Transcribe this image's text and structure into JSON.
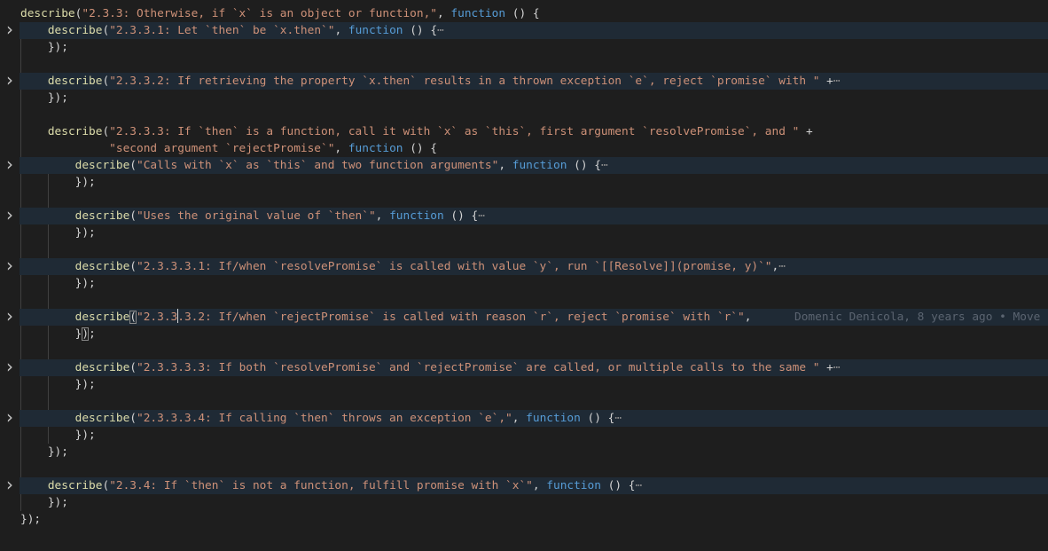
{
  "colors": {
    "background": "#1e1e1e",
    "function": "#dcdcaa",
    "string": "#ce9178",
    "keyword": "#569cd6",
    "fold_highlight": "#1f2a35"
  },
  "fold_icon": "chevron-right-icon",
  "blame": "Domenic Denicola, 8 years ago • Move",
  "lines": [
    {
      "indent": 0,
      "tokens": [
        [
          "fn",
          "describe"
        ],
        [
          "p",
          "("
        ],
        [
          "str",
          "\"2.3.3: Otherwise, if `x` is an object or function,\""
        ],
        [
          "p",
          ", "
        ],
        [
          "kw",
          "function"
        ],
        [
          "p",
          " () {"
        ]
      ]
    },
    {
      "indent": 4,
      "folded": true,
      "tokens": [
        [
          "fn",
          "describe"
        ],
        [
          "p",
          "("
        ],
        [
          "str",
          "\"2.3.3.1: Let `then` be `x.then`\""
        ],
        [
          "p",
          ", "
        ],
        [
          "kw",
          "function"
        ],
        [
          "p",
          " () {"
        ],
        [
          "ell",
          "⋯"
        ]
      ]
    },
    {
      "indent": 4,
      "tokens": [
        [
          "p",
          "});"
        ]
      ]
    },
    {
      "indent": 0,
      "tokens": []
    },
    {
      "indent": 4,
      "folded": true,
      "tokens": [
        [
          "fn",
          "describe"
        ],
        [
          "p",
          "("
        ],
        [
          "str",
          "\"2.3.3.2: If retrieving the property `x.then` results in a thrown exception `e`, reject `promise` with \""
        ],
        [
          "p",
          " +"
        ],
        [
          "ell",
          "⋯"
        ]
      ]
    },
    {
      "indent": 4,
      "tokens": [
        [
          "p",
          "});"
        ]
      ]
    },
    {
      "indent": 0,
      "tokens": []
    },
    {
      "indent": 4,
      "tokens": [
        [
          "fn",
          "describe"
        ],
        [
          "p",
          "("
        ],
        [
          "str",
          "\"2.3.3.3: If `then` is a function, call it with `x` as `this`, first argument `resolvePromise`, and \""
        ],
        [
          "p",
          " +"
        ]
      ]
    },
    {
      "indent": 13,
      "tokens": [
        [
          "str",
          "\"second argument `rejectPromise`\""
        ],
        [
          "p",
          ", "
        ],
        [
          "kw",
          "function"
        ],
        [
          "p",
          " () {"
        ]
      ]
    },
    {
      "indent": 8,
      "folded": true,
      "tokens": [
        [
          "fn",
          "describe"
        ],
        [
          "p",
          "("
        ],
        [
          "str",
          "\"Calls with `x` as `this` and two function arguments\""
        ],
        [
          "p",
          ", "
        ],
        [
          "kw",
          "function"
        ],
        [
          "p",
          " () {"
        ],
        [
          "ell",
          "⋯"
        ]
      ]
    },
    {
      "indent": 8,
      "tokens": [
        [
          "p",
          "});"
        ]
      ]
    },
    {
      "indent": 0,
      "tokens": []
    },
    {
      "indent": 8,
      "folded": true,
      "tokens": [
        [
          "fn",
          "describe"
        ],
        [
          "p",
          "("
        ],
        [
          "str",
          "\"Uses the original value of `then`\""
        ],
        [
          "p",
          ", "
        ],
        [
          "kw",
          "function"
        ],
        [
          "p",
          " () {"
        ],
        [
          "ell",
          "⋯"
        ]
      ]
    },
    {
      "indent": 8,
      "tokens": [
        [
          "p",
          "});"
        ]
      ]
    },
    {
      "indent": 0,
      "tokens": []
    },
    {
      "indent": 8,
      "folded": true,
      "tokens": [
        [
          "fn",
          "describe"
        ],
        [
          "p",
          "("
        ],
        [
          "str",
          "\"2.3.3.3.1: If/when `resolvePromise` is called with value `y`, run `[[Resolve]](promise, y)`\""
        ],
        [
          "p",
          ","
        ],
        [
          "ell",
          "⋯"
        ]
      ]
    },
    {
      "indent": 8,
      "tokens": [
        [
          "p",
          "});"
        ]
      ]
    },
    {
      "indent": 0,
      "tokens": []
    },
    {
      "indent": 8,
      "folded": true,
      "blame": true,
      "tokens": [
        [
          "fn",
          "describe"
        ],
        [
          "bm",
          "("
        ],
        [
          "str",
          "\"2.3.3"
        ],
        [
          "cursor",
          ""
        ],
        [
          "str",
          ".3.2: If/when `rejectPromise` is called with reason `r`, reject `promise` with `r`\""
        ],
        [
          "p",
          ","
        ]
      ]
    },
    {
      "indent": 8,
      "tokens": [
        [
          "p",
          "}"
        ],
        [
          "bm",
          ")"
        ],
        [
          "p",
          ";"
        ]
      ]
    },
    {
      "indent": 0,
      "tokens": []
    },
    {
      "indent": 8,
      "folded": true,
      "tokens": [
        [
          "fn",
          "describe"
        ],
        [
          "p",
          "("
        ],
        [
          "str",
          "\"2.3.3.3.3: If both `resolvePromise` and `rejectPromise` are called, or multiple calls to the same \""
        ],
        [
          "p",
          " +"
        ],
        [
          "ell",
          "⋯"
        ]
      ]
    },
    {
      "indent": 8,
      "tokens": [
        [
          "p",
          "});"
        ]
      ]
    },
    {
      "indent": 0,
      "tokens": []
    },
    {
      "indent": 8,
      "folded": true,
      "tokens": [
        [
          "fn",
          "describe"
        ],
        [
          "p",
          "("
        ],
        [
          "str",
          "\"2.3.3.3.4: If calling `then` throws an exception `e`,\""
        ],
        [
          "p",
          ", "
        ],
        [
          "kw",
          "function"
        ],
        [
          "p",
          " () {"
        ],
        [
          "ell",
          "⋯"
        ]
      ]
    },
    {
      "indent": 8,
      "tokens": [
        [
          "p",
          "});"
        ]
      ]
    },
    {
      "indent": 4,
      "tokens": [
        [
          "p",
          "});"
        ]
      ]
    },
    {
      "indent": 0,
      "tokens": []
    },
    {
      "indent": 4,
      "folded": true,
      "tokens": [
        [
          "fn",
          "describe"
        ],
        [
          "p",
          "("
        ],
        [
          "str",
          "\"2.3.4: If `then` is not a function, fulfill promise with `x`\""
        ],
        [
          "p",
          ", "
        ],
        [
          "kw",
          "function"
        ],
        [
          "p",
          " () {"
        ],
        [
          "ell",
          "⋯"
        ]
      ]
    },
    {
      "indent": 4,
      "tokens": [
        [
          "p",
          "});"
        ]
      ]
    },
    {
      "indent": 0,
      "tokens": [
        [
          "p",
          "});"
        ]
      ]
    }
  ]
}
